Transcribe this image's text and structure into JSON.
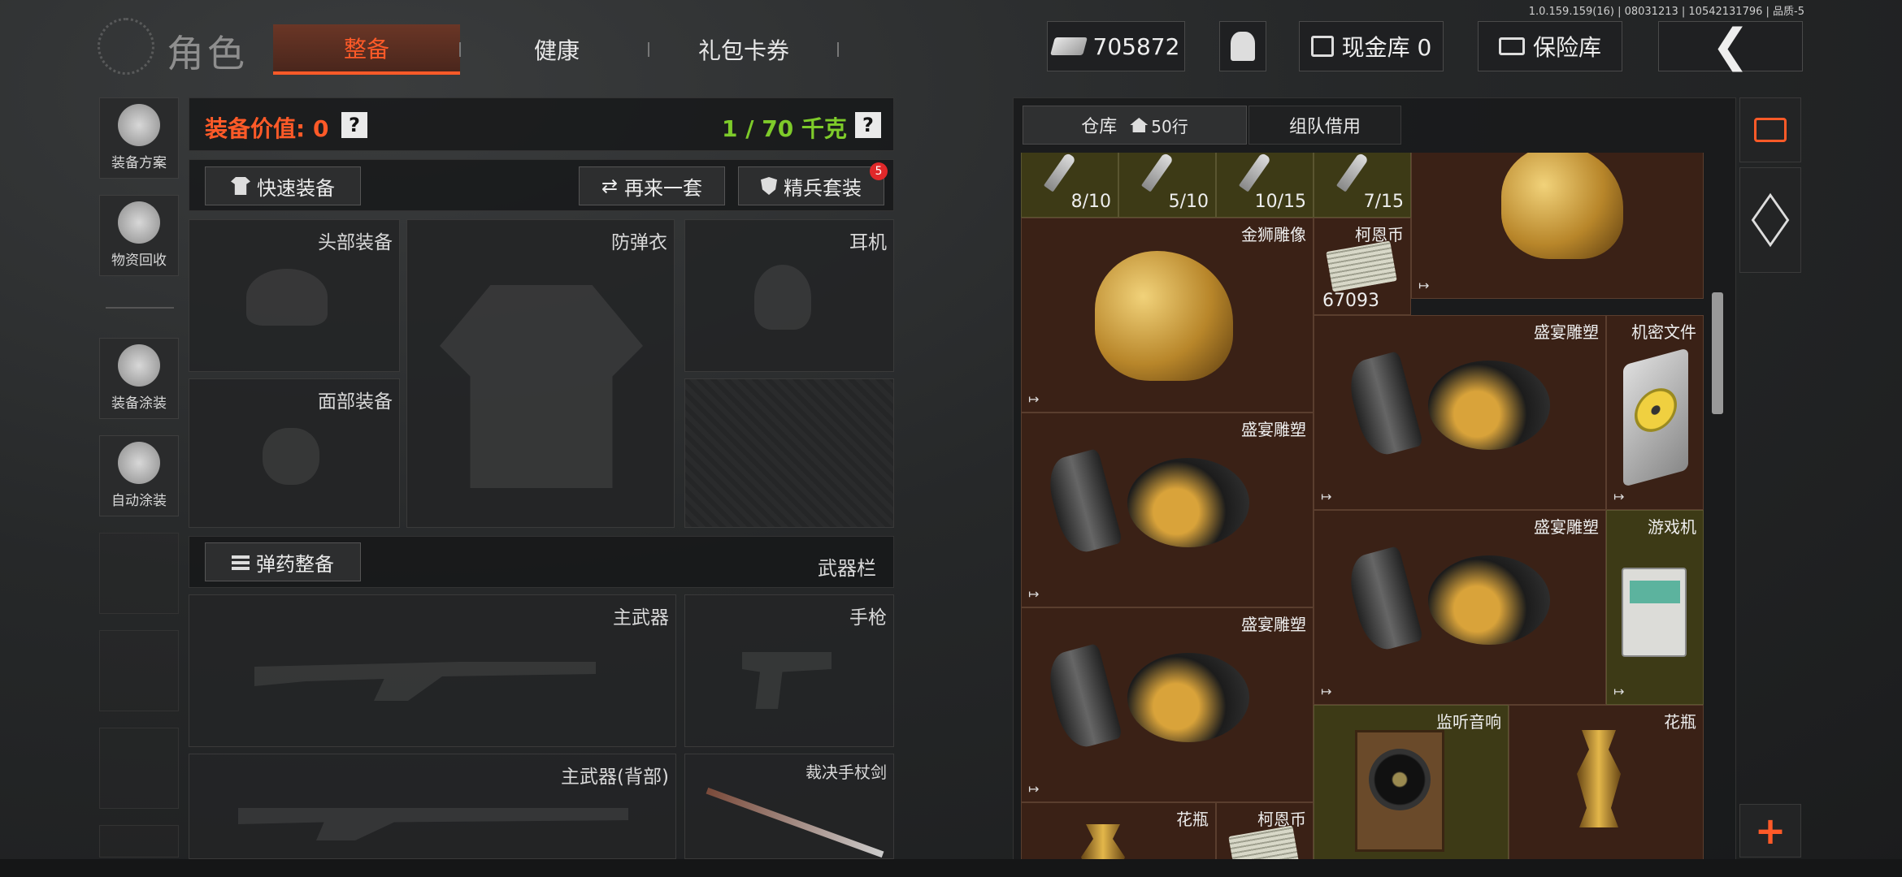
{
  "version": "1.0.159.159(16) | 08031213 | 10542131796 | 品质-5",
  "header": {
    "title": "角色",
    "tabs": [
      "整备",
      "健康",
      "礼包卡券"
    ],
    "money": "705872",
    "cash_vault": "现金库 0",
    "safe_vault": "保险库"
  },
  "sidebar": {
    "items": [
      "装备方案",
      "物资回收",
      "装备涂装",
      "自动涂装"
    ]
  },
  "equipment": {
    "value_label": "装备价值: 0",
    "weight_label": "1 / 70 千克",
    "quick_equip": "快速装备",
    "again_set": "再来一套",
    "elite_set": "精兵套装",
    "elite_badge": "5",
    "slots": {
      "head": "头部装备",
      "armor": "防弹衣",
      "headset": "耳机",
      "face": "面部装备",
      "primary": "主武器",
      "pistol": "手枪",
      "primary_back": "主武器(背部)",
      "melee": "裁决手杖剑"
    },
    "ammo_btn": "弹药整备",
    "weapon_bar": "武器栏"
  },
  "warehouse": {
    "tab_storage": "仓库",
    "tab_rows": "50行",
    "tab_team": "组队借用",
    "keys": [
      "8/10",
      "5/10",
      "10/15",
      "7/15"
    ],
    "items": {
      "gold_lion": "金狮雕像",
      "coin": "柯恩币",
      "coin_count": "67093",
      "feast_statue": "盛宴雕塑",
      "secret_file": "机密文件",
      "game_console": "游戏机",
      "speaker": "监听音响",
      "vase": "花瓶"
    }
  },
  "colors": {
    "accent": "#ff5a28",
    "weight_green": "#7ecb2a",
    "item_bg": "#3a2116",
    "item_olive": "#3d3a16"
  }
}
